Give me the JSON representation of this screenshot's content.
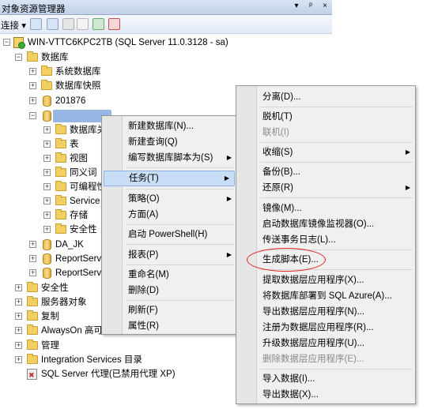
{
  "panel": {
    "title": "对象资源管理器",
    "controls": [
      "▾",
      "ᵖ",
      "×"
    ],
    "connect_label": "连接 ▾"
  },
  "tree": {
    "server": "WIN-VTTC6KPC2TB (SQL Server 11.0.3128 - sa)",
    "databases": "数据库",
    "system_databases": "系统数据库",
    "snapshots": "数据库快照",
    "db_201876": "201876",
    "db_selected": "",
    "child_diagrams": "数据库关",
    "child_tables": "表",
    "child_views": "视图",
    "child_synonyms": "同义词",
    "child_programmability": "可编程性",
    "child_service": "Service",
    "child_storage": "存储",
    "child_security": "安全性",
    "db_da_jk": "DA_JK",
    "db_reportserver": "ReportServ",
    "db_reportserver2": "ReportServ",
    "security": "安全性",
    "server_objects": "服务器对象",
    "replication": "复制",
    "alwayson": "AlwaysOn 高可",
    "management": "管理",
    "integration": "Integration Services 目录",
    "agent": "SQL Server 代理(已禁用代理 XP)"
  },
  "context_menu": {
    "new_database": "新建数据库(N)...",
    "new_query": "新建查询(Q)",
    "script_as": "编写数据库脚本为(S)",
    "tasks": "任务(T)",
    "policies": "策略(O)",
    "facets": "方面(A)",
    "powershell": "启动 PowerShell(H)",
    "reports": "报表(P)",
    "rename": "重命名(M)",
    "delete": "删除(D)",
    "refresh": "刷新(F)",
    "properties": "属性(R)"
  },
  "tasks_menu": {
    "detach": "分离(D)...",
    "take_offline": "脱机(T)",
    "bring_online": "联机(I)",
    "shrink": "收缩(S)",
    "backup": "备份(B)...",
    "restore": "还原(R)",
    "mirror": "镜像(M)...",
    "mirror_monitor": "启动数据库镜像监视器(O)...",
    "log_shipping": "传送事务日志(L)...",
    "generate_scripts": "生成脚本(E)...",
    "extract_dac": "提取数据层应用程序(X)...",
    "deploy_azure": "将数据库部署到 SQL Azure(A)...",
    "export_dac": "导出数据层应用程序(N)...",
    "register_dac": "注册为数据层应用程序(R)...",
    "upgrade_dac": "升级数据层应用程序(U)...",
    "delete_dac": "删除数据层应用程序(E)...",
    "import_data": "导入数据(I)...",
    "export_data": "导出数据(X)..."
  },
  "colors": {
    "highlight": "#c8ddf6",
    "annotation_circle": "#e02020"
  }
}
